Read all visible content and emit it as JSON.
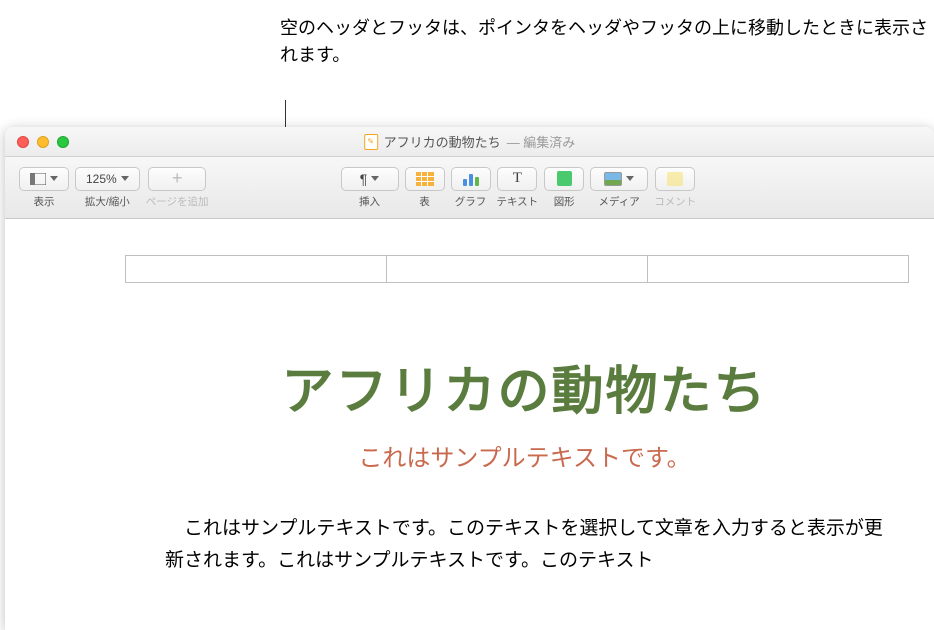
{
  "callout": {
    "text": "空のヘッダとフッタは、ポインタをヘッダやフッタの上に移動したときに表示されます。"
  },
  "window": {
    "title": "アフリカの動物たち",
    "status": "— 編集済み"
  },
  "toolbar": {
    "view": {
      "label": "表示"
    },
    "zoom": {
      "label": "拡大/縮小",
      "value": "125%"
    },
    "addPage": {
      "label": "ページを追加",
      "icon": "+"
    },
    "insert": {
      "label": "挿入",
      "symbol": "¶"
    },
    "table": {
      "label": "表"
    },
    "chart": {
      "label": "グラフ"
    },
    "text": {
      "label": "テキスト",
      "symbol": "T"
    },
    "shape": {
      "label": "図形"
    },
    "media": {
      "label": "メディア"
    },
    "comment": {
      "label": "コメント"
    }
  },
  "document": {
    "title": "アフリカの動物たち",
    "subtitle": "これはサンプルテキストです。",
    "body": "これはサンプルテキストです。このテキストを選択して文章を入力すると表示が更新されます。これはサンプルテキストです。このテキスト"
  }
}
